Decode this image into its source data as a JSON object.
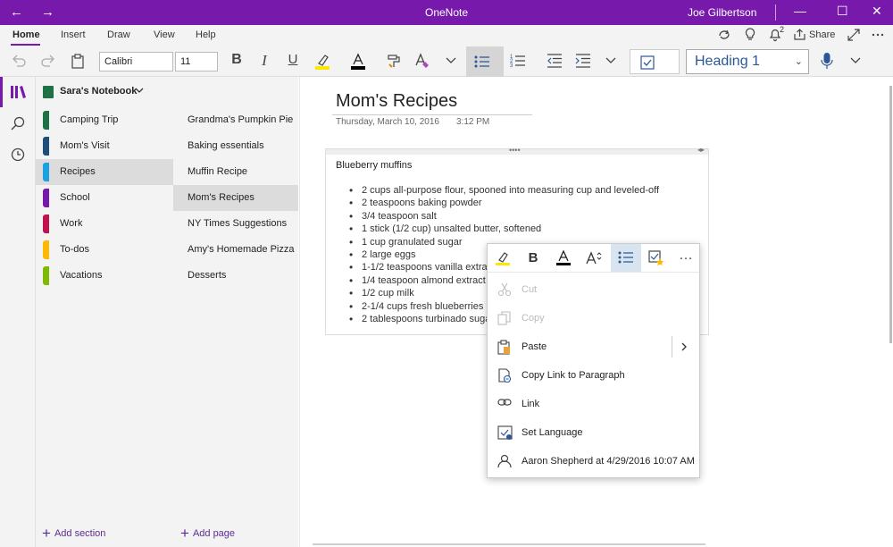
{
  "window": {
    "title": "OneNote",
    "user": "Joe Gilbertson",
    "back_icon": "←",
    "forward_icon": "→",
    "minimize_icon": "—",
    "maximize_icon": "☐",
    "close_icon": "✕"
  },
  "ribbon": {
    "tabs": [
      "Home",
      "Insert",
      "Draw",
      "View",
      "Help"
    ],
    "active_tab": "Home",
    "share_label": "Share",
    "notification_count": "2"
  },
  "toolbar": {
    "font_name": "Calibri",
    "font_size": "11",
    "bold": "B",
    "italic": "I",
    "underline": "U",
    "style_selected": "Heading 1",
    "highlight_color": "#ffe600",
    "font_color": "#000000"
  },
  "notebook": {
    "name": "Sara's Notebook",
    "color": "#1e7145",
    "sections": [
      {
        "label": "Camping Trip",
        "color": "#1e7145"
      },
      {
        "label": "Mom's Visit",
        "color": "#1f4e79"
      },
      {
        "label": "Recipes",
        "color": "#1ba1e2"
      },
      {
        "label": "School",
        "color": "#7719aa"
      },
      {
        "label": "Work",
        "color": "#c0124f"
      },
      {
        "label": "To-dos",
        "color": "#ffb900"
      },
      {
        "label": "Vacations",
        "color": "#7fba00"
      }
    ],
    "selected_section": "Recipes",
    "add_section_label": "Add section"
  },
  "pages": {
    "items": [
      "Grandma's Pumpkin Pie",
      "Baking essentials",
      "Muffin Recipe",
      "Mom's Recipes",
      "NY Times Suggestions",
      "Amy's Homemade Pizza",
      "Desserts"
    ],
    "selected_page": "Mom's Recipes",
    "add_page_label": "Add page"
  },
  "page": {
    "title": "Mom's Recipes",
    "date": "Thursday, March 10, 2016",
    "time": "3:12 PM",
    "note_heading": "Blueberry muffins",
    "ingredients": [
      "2 cups all-purpose flour, spooned into measuring cup and leveled-off",
      "2 teaspoons baking powder",
      "3/4 teaspoon salt",
      "1 stick (1/2 cup) unsalted butter, softened",
      "1 cup granulated sugar",
      "2 large eggs",
      "1-1/2 teaspoons vanilla extract",
      "1/4 teaspoon almond extract",
      "1/2 cup milk",
      "2-1/4 cups fresh blueberries",
      "2 tablespoons turbinado sugar"
    ]
  },
  "context_menu": {
    "items": [
      {
        "label": "Cut",
        "icon": "scissors-icon",
        "enabled": false
      },
      {
        "label": "Copy",
        "icon": "copy-icon",
        "enabled": false
      },
      {
        "label": "Paste",
        "icon": "paste-icon",
        "enabled": true
      },
      {
        "label": "Copy Link to Paragraph",
        "icon": "link-paragraph-icon",
        "enabled": true
      },
      {
        "label": "Link",
        "icon": "link-icon",
        "enabled": true
      },
      {
        "label": "Set Language",
        "icon": "language-icon",
        "enabled": true
      },
      {
        "label": "Aaron Shepherd at 4/29/2016 10:07 AM",
        "icon": "person-icon",
        "enabled": true
      }
    ],
    "toolbar_bold": "B",
    "toolbar_more": "···"
  }
}
